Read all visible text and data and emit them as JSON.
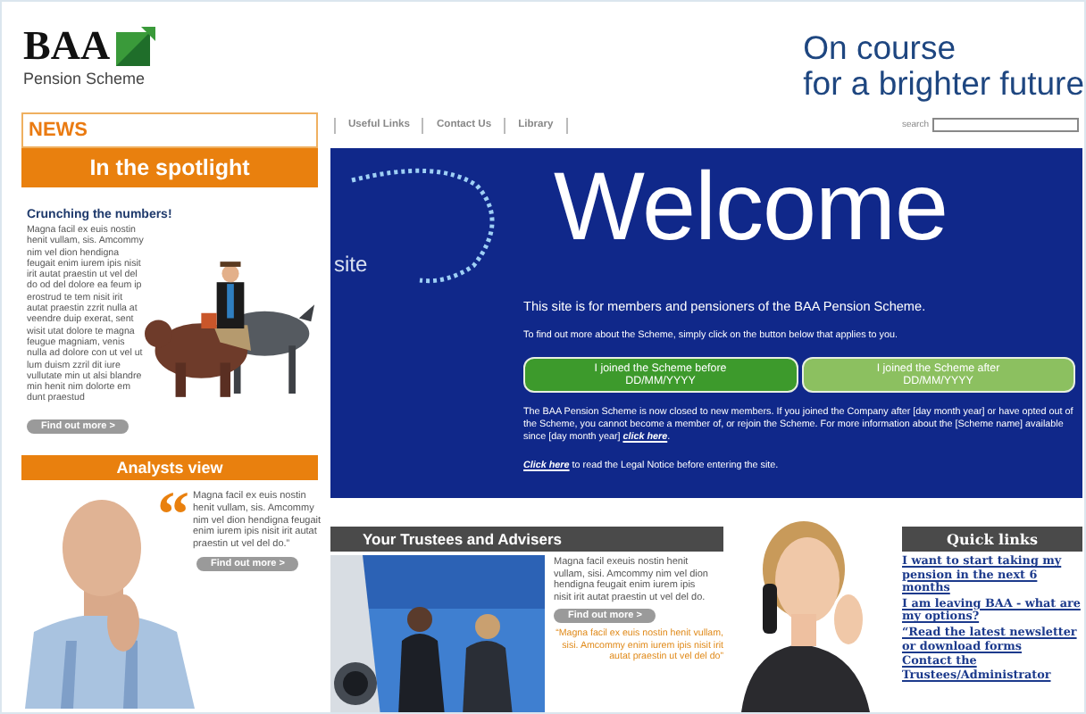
{
  "header": {
    "logo": "BAA",
    "subtitle": "Pension Scheme",
    "tagline": [
      "On course",
      "for a brighter future"
    ]
  },
  "nav": {
    "links": [
      "Useful Links",
      "Contact Us",
      "Library"
    ],
    "search_label": "search"
  },
  "news": {
    "title": "NEWS",
    "banner": "In the spotlight",
    "heading": "Crunching the numbers!",
    "body": "Magna facil ex euis nostin henit vullam, sis. Amcommy nim vel dion hendigna feugait enim iurem ipis nisit irit autat praestin ut vel del do od del dolore ea feum ip erostrud te tem nisit irit autat praestin zzrit nulla at veendre duip exerat, sent wisit utat dolore te magna feugue magniam, venis nulla ad dolore con ut vel ut lum duism zzril dit iure vullutate min ut alsi blandre min henit nim dolorte em dunt praestud",
    "button": "Find out more >"
  },
  "analysts": {
    "title": "Analysts view",
    "quote_mark": "“",
    "quote": "Magna facil ex euis nostin henit vullam, sis. Amcommy nim vel dion hendigna feugait enim iurem ipis nisit irit autat praestin ut vel del do.”",
    "button": "Find out more >"
  },
  "welcome": {
    "side_text": "site",
    "title": "Welcome",
    "intro": "This site is for members and pensioners of the BAA Pension Scheme.",
    "instruction": "To find out more about the Scheme, simply click on the button below that applies to you.",
    "buttons": [
      {
        "label": "I joined the Scheme before",
        "date": "DD/MM/YYYY",
        "color": "#3d9a2c"
      },
      {
        "label": "I joined the Scheme after",
        "date": "DD/MM/YYYY",
        "color": "#8cc060"
      }
    ],
    "notice": "The BAA Pension Scheme is now closed to new members. If you joined the Company after [day month year] or have opted out of the Scheme, you cannot become a member of, or rejoin the Scheme. For more information about the [Scheme name] available since [day month year]",
    "notice_link": "click here",
    "notice_end": ".",
    "legal_link": "Click here",
    "legal_text": "to read the Legal Notice before entering the site."
  },
  "trustees": {
    "title": "Your Trustees and Advisers",
    "body": "Magna facil exeuis nostin henit vullam, sisi. Amcommy nim vel dion hendigna feugait enim iurem ipis nisit irit autat praestin ut vel del do.",
    "button": "Find out more >",
    "quote": "“Magna facil ex euis nostin henit vullam, sisi. Amcommy enim iurem ipis nisit irit autat praestin ut vel del do”"
  },
  "quick_links": {
    "title": "Quick links",
    "links": [
      "I want to start taking my pension in the next 6 months",
      "I am leaving BAA - what are my options?",
      "“Read the latest newsletter or download forms",
      "Contact the Trustees/Administrator"
    ]
  }
}
